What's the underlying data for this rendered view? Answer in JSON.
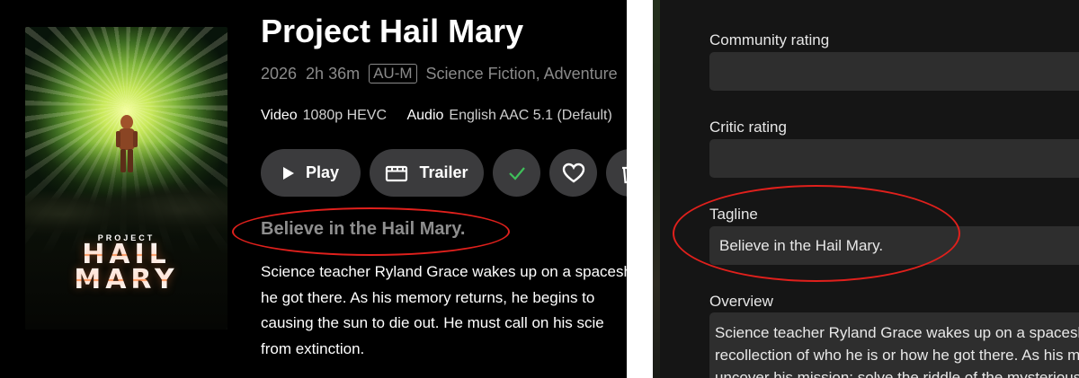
{
  "details": {
    "poster": {
      "small_title": "PROJECT",
      "big_title_line1": "HAIL",
      "big_title_line2": "MARY"
    },
    "title": "Project Hail Mary",
    "meta": {
      "year": "2026",
      "runtime": "2h 36m",
      "rating": "AU-M",
      "genres": "Science Fiction, Adventure"
    },
    "streams": {
      "video_label": "Video",
      "video_value": "1080p HEVC",
      "audio_label": "Audio",
      "audio_value": "English AAC 5.1 (Default)"
    },
    "buttons": {
      "play": "Play",
      "trailer": "Trailer"
    },
    "tagline": "Believe in the Hail Mary.",
    "overview_lines": [
      "Science teacher Ryland Grace wakes up on a spaceship",
      "he got there. As his memory returns, he begins to",
      "causing the sun to die out. He must call on his scie",
      "from extinction."
    ]
  },
  "editor": {
    "community_rating": {
      "label": "Community rating",
      "value": ""
    },
    "critic_rating": {
      "label": "Critic rating",
      "value": ""
    },
    "tagline": {
      "label": "Tagline",
      "value": "Believe in the Hail Mary."
    },
    "overview": {
      "label": "Overview",
      "lines": [
        "Science teacher Ryland Grace wakes up on a spaceship",
        "recollection of who he is or how he got there. As his m",
        "uncover his mission: solve the riddle of the mysterious"
      ]
    }
  },
  "colors": {
    "highlight_ellipse": "#e0201c",
    "watched_check": "#3fbf5a",
    "button_bg": "#3b3b3d"
  }
}
